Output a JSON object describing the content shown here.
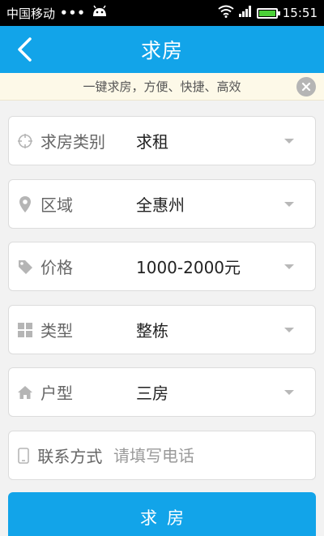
{
  "status_bar": {
    "carrier": "中国移动",
    "dots": "•••",
    "time": "15:51"
  },
  "header": {
    "title": "求房"
  },
  "notice": {
    "text": "一键求房，方便、快捷、高效"
  },
  "form": {
    "category": {
      "label": "求房类别",
      "value": "求租",
      "icon": "crosshair-icon"
    },
    "area": {
      "label": "区域",
      "value": "全惠州",
      "icon": "location-pin-icon"
    },
    "price": {
      "label": "价格",
      "value": "1000-2000元",
      "icon": "price-tag-icon"
    },
    "type": {
      "label": "类型",
      "value": "整栋",
      "icon": "grid-icon"
    },
    "layout": {
      "label": "户型",
      "value": "三房",
      "icon": "house-icon"
    },
    "contact": {
      "label": "联系方式",
      "placeholder": "请填写电话",
      "icon": "phone-icon"
    }
  },
  "submit": {
    "label": "求房"
  },
  "colors": {
    "primary": "#12a4e9",
    "notice_bg": "#fdf9e8",
    "battery": "#4cd138"
  }
}
